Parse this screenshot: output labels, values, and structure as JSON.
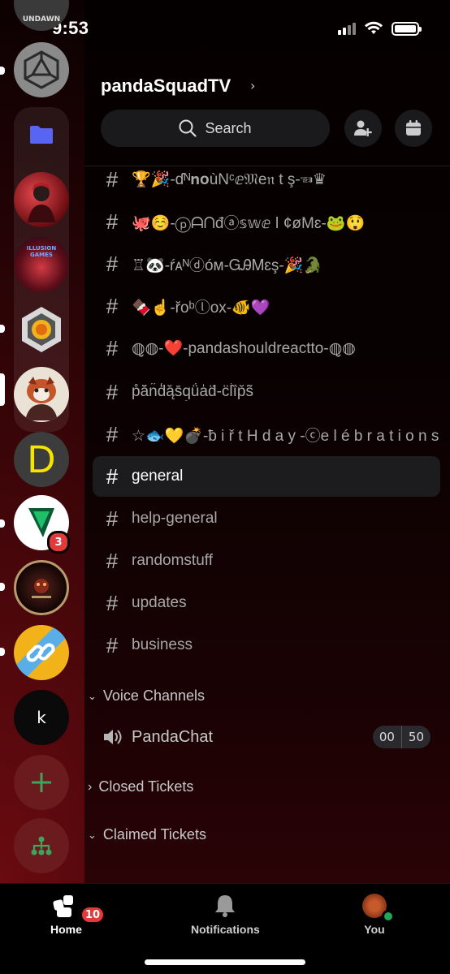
{
  "status": {
    "time": "9:53"
  },
  "rail": {
    "top_server_label": "UNDAWN",
    "servers": [
      {
        "name": "hexagon-server",
        "icon": "hexagon-logo"
      },
      {
        "name": "folder",
        "icon": "folder-icon"
      },
      {
        "name": "anime-server"
      },
      {
        "name": "illusion-games-server",
        "label": "ILLUSION GAMES"
      },
      {
        "name": "badge-server",
        "icon": "shield-icon"
      },
      {
        "name": "panda-server"
      },
      {
        "name": "d-server",
        "letter": "D"
      },
      {
        "name": "green-logo-server",
        "badge": "3"
      },
      {
        "name": "dark-emblem-server"
      },
      {
        "name": "chain-server",
        "icon": "link-icon"
      },
      {
        "name": "k-server",
        "letter": "k"
      }
    ],
    "add_server_icon": "plus-icon",
    "discover_icon": "hierarchy-icon",
    "accent": "#3ba55c"
  },
  "header": {
    "server_name": "pandaSquadTV",
    "search_label": "Search"
  },
  "channels": [
    {
      "name": "🏆🎉-ɗᴺ𝐧𝐨ùNᶜⅇ𝔐e𝔫 t ş-☜♛"
    },
    {
      "name": "🐙☺️-ⓟᗩᑎđⓐ𝕤𝕨ⅇ ǀ ¢øMɛ-🐸😲"
    },
    {
      "name": "♖🐼-ŕᴀᴺⓓóм-ᏀᎯᎷɛş-🎉🐊"
    },
    {
      "name": "🍫☝️-řᴏᵇⓛᴏx-🐠💜"
    },
    {
      "name": "◍̮◍-❤️-pandashouldreactto-◍̮◍"
    },
    {
      "name": "p̊ā̆n̋d̒ą̆s̄q̗ǘa̍d̈-c̈l̍ȉp̆s̃"
    },
    {
      "name": "☆🐟💛💣-ƀ i ř t H d a y -ⓒe l é b r a t i o n s"
    },
    {
      "name": "general",
      "active": true
    },
    {
      "name": "help-general"
    },
    {
      "name": "randomstuff"
    },
    {
      "name": "updates"
    },
    {
      "name": "business"
    }
  ],
  "categories": {
    "voice": "Voice Channels",
    "closed": "Closed Tickets",
    "claimed": "Claimed Tickets"
  },
  "voice_channel": {
    "name": "PandaChat",
    "current": "00",
    "limit": "50"
  },
  "tabbar": {
    "home": "Home",
    "home_badge": "10",
    "notifications": "Notifications",
    "you": "You"
  }
}
